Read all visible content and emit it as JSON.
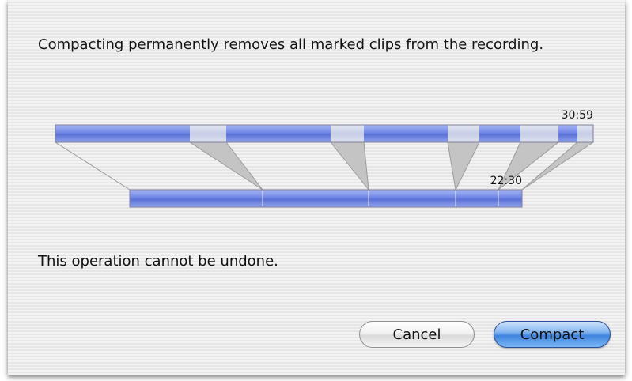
{
  "dialog": {
    "message": "Compacting permanently removes all marked clips from the recording.",
    "warning": "This operation cannot be undone."
  },
  "timeline": {
    "original_duration": "30:59",
    "compacted_duration": "22:30"
  },
  "buttons": {
    "cancel": "Cancel",
    "compact": "Compact"
  },
  "colors": {
    "kept_segment": "#6f86e6",
    "marked_segment": "#c6cde6",
    "default_button": "#3f84de"
  }
}
